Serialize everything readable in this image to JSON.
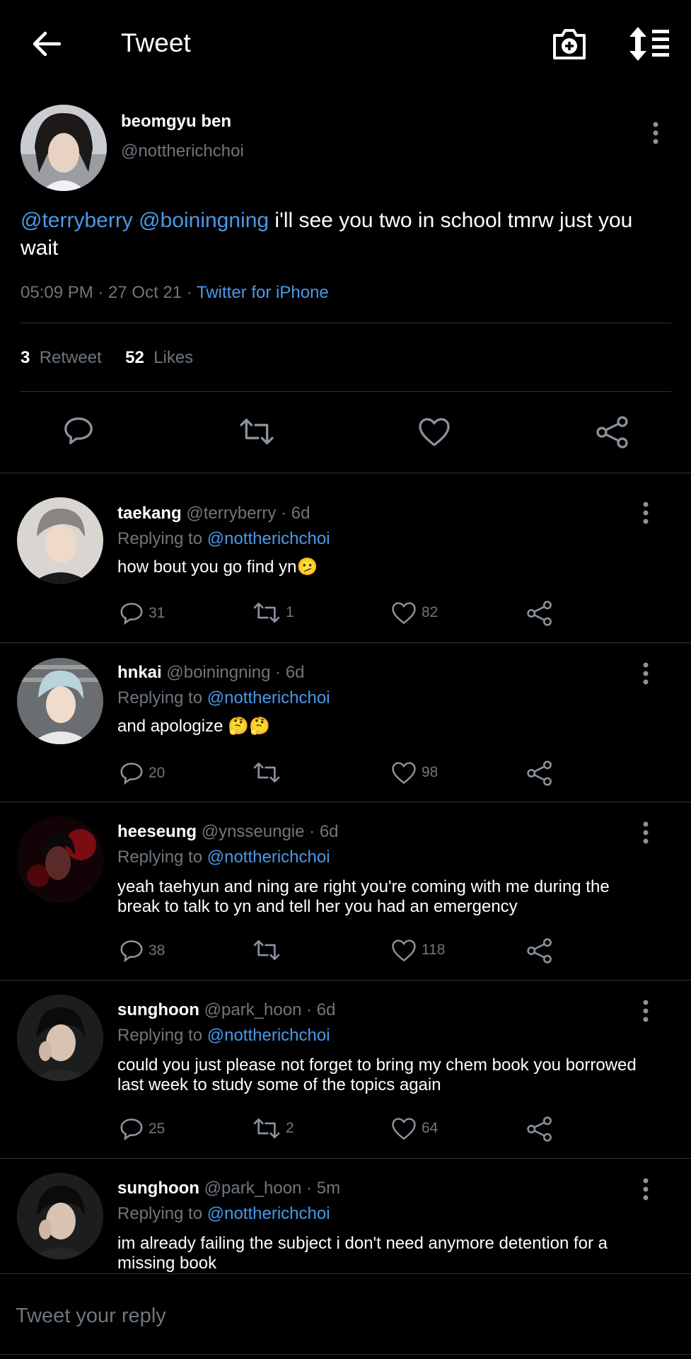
{
  "header": {
    "title": "Tweet",
    "back_icon": "arrow-left-icon",
    "camera_icon": "camera-plus-icon",
    "sort_icon": "sort-list-icon"
  },
  "main_tweet": {
    "name": "beomgyu ben",
    "handle": "@nottherichchoi",
    "mention1": "@terryberry",
    "mention2": "@boiningning",
    "text": " i'll see you two in school tmrw just you wait",
    "time": "05:09 PM · 27 Oct 21 · ",
    "source": "Twitter for iPhone",
    "retweet_count": "3",
    "retweet_label": "Retweet",
    "likes_count": "52",
    "likes_label": "Likes"
  },
  "replies": [
    {
      "name": "taekang",
      "handle": "@terryberry",
      "time": "· 6d",
      "replying_label": "Replying to ",
      "replying_to": "@nottherichchoi",
      "text": "how bout you go find yn🫤",
      "comments": "31",
      "retweets": "1",
      "likes": "82"
    },
    {
      "name": "hnkai",
      "handle": "@boiningning",
      "time": "· 6d",
      "replying_label": "Replying to ",
      "replying_to": "@nottherichchoi",
      "text": "and apologize 🤔🤔",
      "comments": "20",
      "retweets": "",
      "likes": "98"
    },
    {
      "name": "heeseung",
      "handle": " @ynsseungie",
      "time": "· 6d",
      "replying_label": "Replying to ",
      "replying_to": "@nottherichchoi",
      "text": "yeah taehyun and ning are right you're coming with me during the break to talk to yn and tell her you had an emergency",
      "comments": "38",
      "retweets": "",
      "likes": "118"
    },
    {
      "name": "sunghoon",
      "handle": "@park_hoon",
      "time": "· 6d",
      "replying_label": "Replying to ",
      "replying_to": "@nottherichchoi",
      "text": "could you just please not forget to bring my chem book you borrowed last week to study some of the topics again",
      "comments": "25",
      "retweets": "2",
      "likes": "64"
    },
    {
      "name": "sunghoon",
      "handle": "@park_hoon",
      "time": "· 5m",
      "replying_label": "Replying to ",
      "replying_to": "@nottherichchoi",
      "text": "im already failing the subject i don't need anymore detention for a missing book",
      "comments": "",
      "retweets": "",
      "likes": ""
    }
  ],
  "composer": {
    "placeholder": "Tweet your reply"
  },
  "colors": {
    "background": "#000000",
    "link": "#4a99e9",
    "muted": "#6e767d",
    "divider": "#2f3336"
  }
}
